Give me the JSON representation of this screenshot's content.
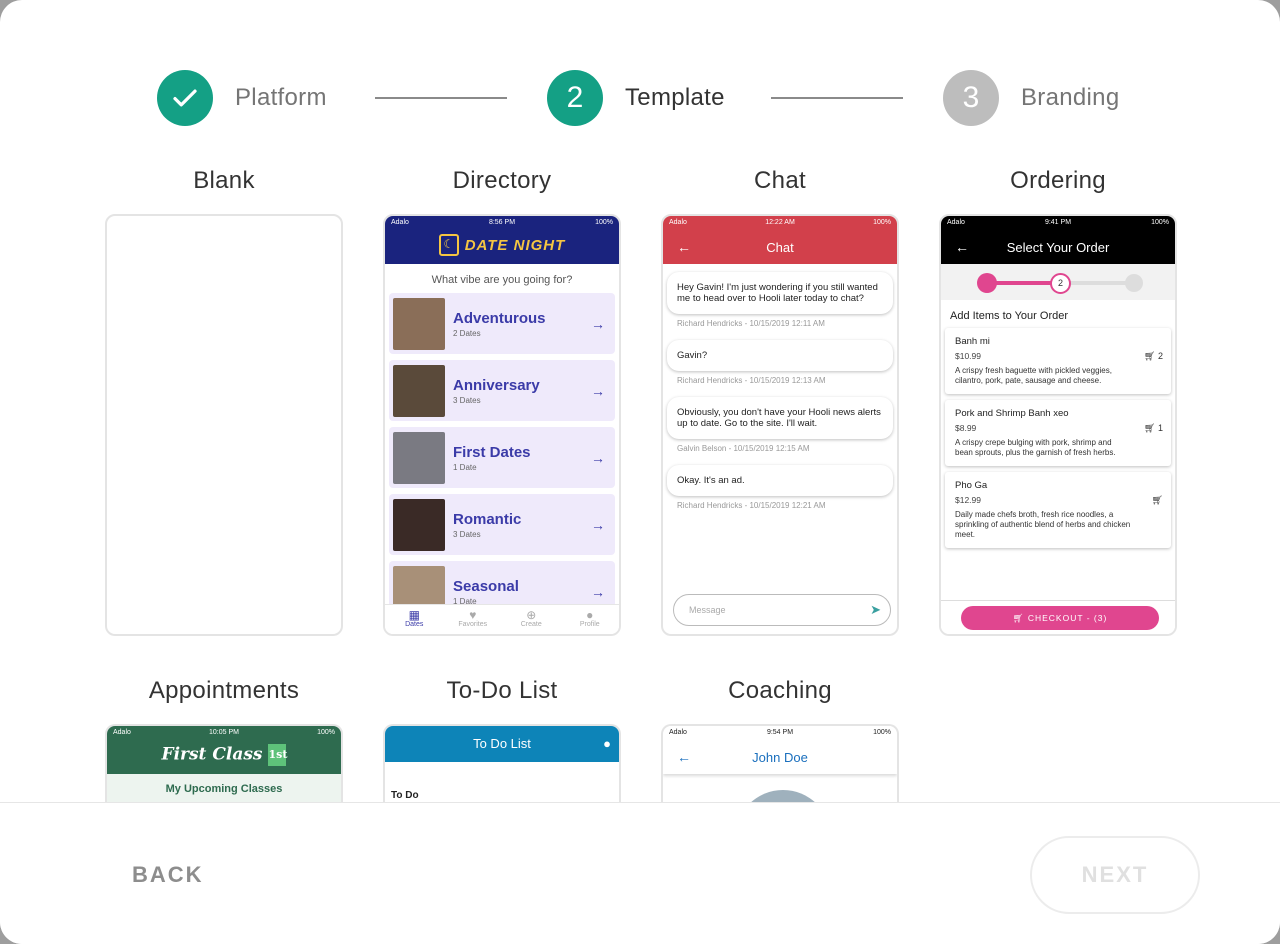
{
  "stepper": {
    "steps": [
      {
        "label": "Platform",
        "number": "",
        "state": "done"
      },
      {
        "label": "Template",
        "number": "2",
        "state": "active"
      },
      {
        "label": "Branding",
        "number": "3",
        "state": "todo"
      }
    ]
  },
  "templates": {
    "blank": {
      "title": "Blank"
    },
    "directory": {
      "title": "Directory",
      "status": {
        "carrier": "Adalo",
        "time": "8:56 PM",
        "battery": "100%"
      },
      "brand": "DATE NIGHT",
      "question": "What vibe are you going for?",
      "items": [
        {
          "name": "Adventurous",
          "count": "2 Dates",
          "color": "#8a6e58"
        },
        {
          "name": "Anniversary",
          "count": "3 Dates",
          "color": "#5a4a3a"
        },
        {
          "name": "First Dates",
          "count": "1 Date",
          "color": "#7a7a82"
        },
        {
          "name": "Romantic",
          "count": "3 Dates",
          "color": "#3a2a26"
        },
        {
          "name": "Seasonal",
          "count": "1 Date",
          "color": "#a89078"
        }
      ],
      "tabs": [
        "Dates",
        "Favorites",
        "Create",
        "Profile"
      ]
    },
    "chat": {
      "title": "Chat",
      "status": {
        "carrier": "Adalo",
        "time": "12:22 AM",
        "battery": "100%"
      },
      "header": "Chat",
      "messages": [
        {
          "text": "Hey Gavin! I'm just wondering if you still wanted me to head over to Hooli later today to chat?",
          "meta": "Richard Hendricks - 10/15/2019 12:11 AM"
        },
        {
          "text": "Gavin?",
          "meta": "Richard Hendricks - 10/15/2019 12:13 AM"
        },
        {
          "text": "Obviously, you don't have your Hooli news alerts up to date. Go to the site. I'll wait.",
          "meta": "Galvin Belson - 10/15/2019 12:15 AM"
        },
        {
          "text": "Okay. It's an ad.",
          "meta": "Richard Hendricks - 10/15/2019 12:21 AM"
        }
      ],
      "input_placeholder": "Message"
    },
    "ordering": {
      "title": "Ordering",
      "status": {
        "carrier": "Adalo",
        "time": "9:41 PM",
        "battery": "100%"
      },
      "header": "Select Your Order",
      "step_number": "2",
      "section": "Add Items to Your Order",
      "items": [
        {
          "name": "Banh mi",
          "price": "$10.99",
          "desc": "A crispy fresh baguette with pickled veggies, cilantro, pork, pate, sausage and cheese.",
          "qty": "2"
        },
        {
          "name": "Pork and Shrimp Banh xeo",
          "price": "$8.99",
          "desc": "A crispy crepe bulging with pork, shrimp and bean sprouts, plus the garnish of fresh herbs.",
          "qty": "1"
        },
        {
          "name": "Pho Ga",
          "price": "$12.99",
          "desc": "Daily made chefs broth, fresh rice noodles, a sprinkling of authentic blend of herbs and chicken meet.",
          "qty": ""
        }
      ],
      "checkout": "CHECKOUT - (3)"
    },
    "appointments": {
      "title": "Appointments",
      "status": {
        "carrier": "Adalo",
        "time": "10:05 PM",
        "battery": "100%"
      },
      "brand": "First Class",
      "badge": "1st",
      "subheader": "My Upcoming Classes"
    },
    "todo": {
      "title": "To-Do List",
      "header": "To Do List",
      "section": "To Do"
    },
    "coaching": {
      "title": "Coaching",
      "status": {
        "carrier": "Adalo",
        "time": "9:54 PM",
        "battery": "100%"
      },
      "header": "John Doe"
    }
  },
  "footer": {
    "back": "BACK",
    "next": "NEXT"
  },
  "colors": {
    "accent": "#14a085",
    "inactive": "#bdbdbd",
    "ordering_pink": "#e0468f",
    "chat_red": "#d2404b",
    "directory_navy": "#1a237e"
  },
  "icons": {
    "done": "check-icon",
    "back_arrow": "arrow-left-icon",
    "item_arrow": "arrow-right-icon",
    "send": "send-icon",
    "cart": "cart-icon",
    "account": "account-icon"
  }
}
